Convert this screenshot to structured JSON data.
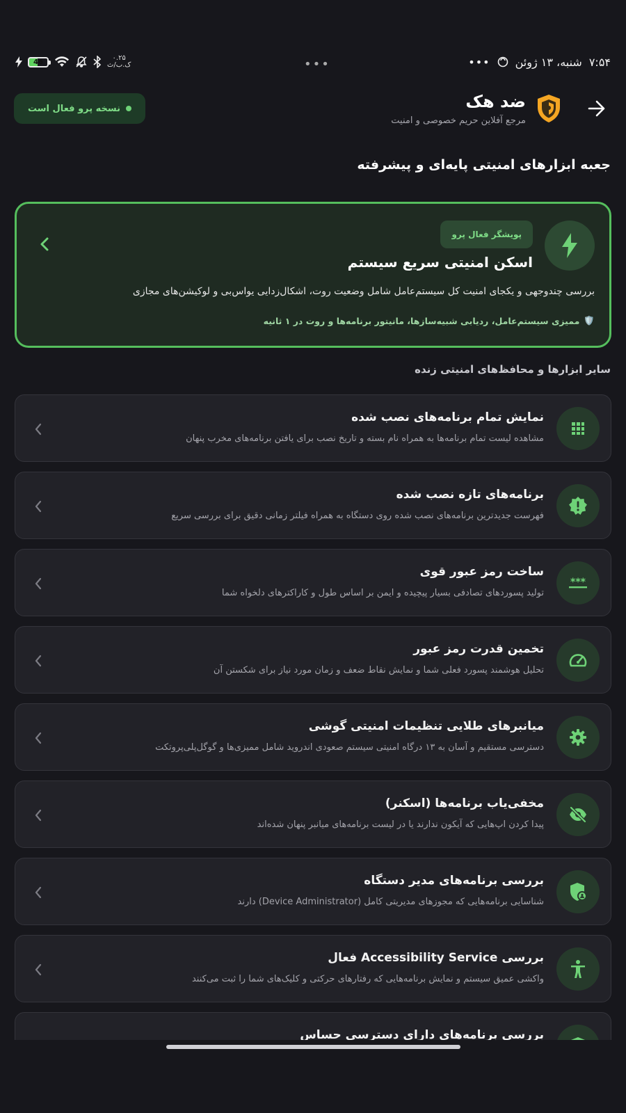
{
  "status_bar": {
    "time": "۷:۵۴",
    "date": "شنبه، ۱۳ ژوئن",
    "battery": "46",
    "more_dots": "•••",
    "speed": "۰.۲۵",
    "speed_unit": "ک.ب/ث"
  },
  "header": {
    "app_title": "ضد هک",
    "app_subtitle": "مرجع آفلاین حریم خصوصی و امنیت",
    "pro_chip": "نسخه پرو فعال است"
  },
  "section_title": "جعبه ابزارهای امنیتی پایه‌ای و پیشرفته",
  "feature": {
    "badge": "پویشگر فعال پرو",
    "title": "اسکن امنیتی سریع سیستم",
    "description": "بررسی چندوجهی و یکجای امنیت کل سیستم‌عامل شامل وضعیت روت، اشکال‌زدایی یواس‌بی و لوکیشن‌های مجازی",
    "features_icon": "🛡️",
    "features": "ممیزی سیستم‌عامل، ردیابی شبیه‌سازها، مانیتور برنامه‌ها و روت در ۱ ثانیه"
  },
  "subsection_title": "سایر ابزارها و محافظ‌های امنیتی زنده",
  "tools": [
    {
      "icon": "grid-icon",
      "title": "نمایش تمام برنامه‌های نصب شده",
      "desc": "مشاهده لیست تمام برنامه‌ها به همراه نام بسته و تاریخ نصب برای یافتن برنامه‌های مخرب پنهان"
    },
    {
      "icon": "alert-badge-icon",
      "title": "برنامه‌های تازه نصب شده",
      "desc": "فهرست جدیدترین برنامه‌های نصب شده روی دستگاه به همراه فیلتر زمانی دقیق برای بررسی سریع"
    },
    {
      "icon": "password-icon",
      "title": "ساخت رمز عبور قوی",
      "desc": "تولید پسوردهای تصادفی بسیار پیچیده و ایمن بر اساس طول و کاراکترهای دلخواه شما"
    },
    {
      "icon": "speedometer-icon",
      "title": "تخمین قدرت رمز عبور",
      "desc": "تحلیل هوشمند پسورد فعلی شما و نمایش نقاط ضعف و زمان مورد نیاز برای شکستن آن"
    },
    {
      "icon": "gear-icon",
      "title": "میانبرهای طلایی تنظیمات امنیتی گوشی",
      "desc": "دسترسی مستقیم و آسان به ۱۳ درگاه امنیتی سیستم صعودی اندروید شامل ممیزی‌ها و گوگل‌پلی‌پروتکت"
    },
    {
      "icon": "eye-off-icon",
      "title": "مخفی‌یاب برنامه‌ها (اسکنر)",
      "desc": "پیدا کردن اپ‌هایی که آیکون ندارند یا در لیست برنامه‌های میانبر پنهان شده‌اند"
    },
    {
      "icon": "admin-shield-icon",
      "title": "بررسی برنامه‌های مدیر دستگاه",
      "desc": "شناسایی برنامه‌هایی که مجوزهای مدیریتی کامل (Device Administrator) دارند"
    },
    {
      "icon": "accessibility-icon",
      "title": "بررسی Accessibility Service فعال",
      "desc": "واکشی عمیق سیستم و نمایش برنامه‌هایی که رفتارهای حرکتی و کلیک‌های شما را ثبت می‌کنند"
    },
    {
      "icon": "shield-icon",
      "title": "بررسی برنامه‌های دارای دسترسی حساس",
      "desc": ""
    }
  ],
  "colors": {
    "background": "#17171c",
    "accent_green": "#55be5d",
    "card": "#222228",
    "logo_orange": "#f5a623"
  }
}
